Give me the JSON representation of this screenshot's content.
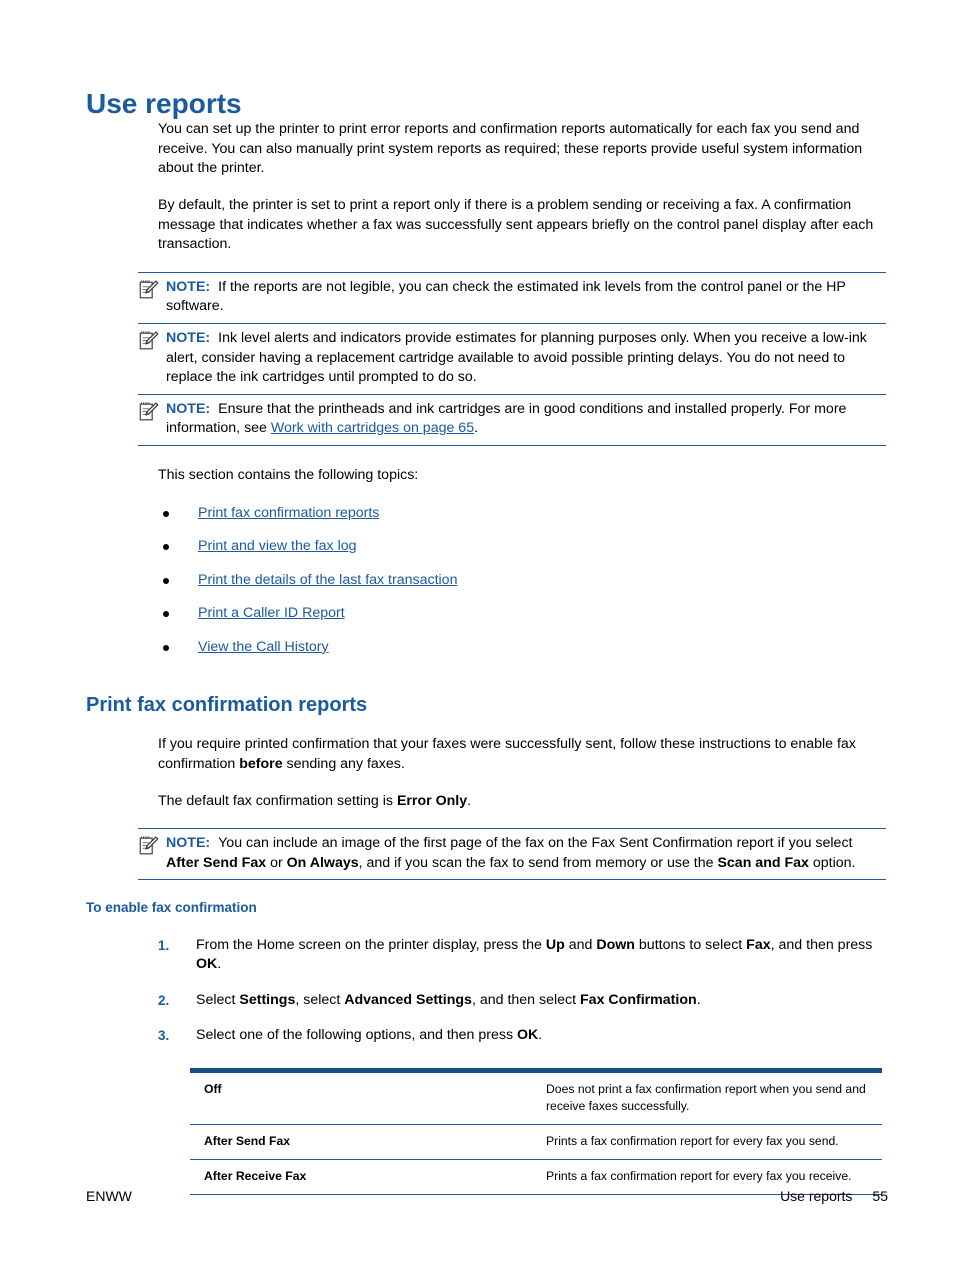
{
  "page": {
    "title": "Use reports",
    "accent_color": "#1a5a9e",
    "table_rule_color": "#1a4f86"
  },
  "intro": {
    "paragraph_1": "You can set up the printer to print error reports and confirmation reports automatically for each fax you send and receive. You can also manually print system reports as required; these reports provide useful system information about the printer.",
    "paragraph_2": "By default, the printer is set to print a report only if there is a problem sending or receiving a fax. A confirmation message that indicates whether a fax was successfully sent appears briefly on the control panel display after each transaction."
  },
  "notes": [
    {
      "label": "NOTE:",
      "icon": "note-pencil-icon",
      "text": "If the reports are not legible, you can check the estimated ink levels from the control panel or the HP software."
    },
    {
      "label": "NOTE:",
      "icon": "note-pencil-icon",
      "text": "Ink level alerts and indicators provide estimates for planning purposes only. When you receive a low-ink alert, consider having a replacement cartridge available to avoid possible printing delays. You do not need to replace the ink cartridges until prompted to do so."
    },
    {
      "label": "NOTE:",
      "icon": "note-pencil-icon",
      "text_before_link": "Ensure that the printheads and ink cartridges are in good conditions and installed properly. For more information, see ",
      "link_text": "Work with cartridges on page 65",
      "text_after_link": "."
    }
  ],
  "topics_intro": "This section contains the following topics:",
  "topics": [
    {
      "label": "Print fax confirmation reports"
    },
    {
      "label": "Print and view the fax log"
    },
    {
      "label": "Print the details of the last fax transaction"
    },
    {
      "label": "Print a Caller ID Report"
    },
    {
      "label": "View the Call History"
    }
  ],
  "section": {
    "heading": "Print fax confirmation reports",
    "paragraph_1_part1": "If you require printed confirmation that your faxes were successfully sent, follow these instructions to enable fax confirmation ",
    "paragraph_1_bold": "before",
    "paragraph_1_part2": " sending any faxes.",
    "paragraph_2_part1": "The default fax confirmation setting is ",
    "paragraph_2_bold": "Error Only",
    "paragraph_2_part2": ".",
    "note": {
      "label": "NOTE:",
      "icon": "note-pencil-icon",
      "part1": "You can include an image of the first page of the fax on the Fax Sent Confirmation report if you select ",
      "bold1": "After Send Fax",
      "part2": " or ",
      "bold2": "On Always",
      "part3": ", and if you scan the fax to send from memory or use the ",
      "bold3": "Scan and Fax",
      "part4": " option."
    },
    "subheading": "To enable fax confirmation",
    "steps": [
      {
        "number": "1.",
        "part1": "From the Home screen on the printer display, press the ",
        "bold1": "Up",
        "part2": " and ",
        "bold2": "Down",
        "part3": " buttons to select ",
        "bold3": "Fax",
        "part4": ", and then press ",
        "bold4": "OK",
        "part5": "."
      },
      {
        "number": "2.",
        "part1": "Select ",
        "bold1": "Settings",
        "part2": ", select ",
        "bold2": "Advanced Settings",
        "part3": ", and then select ",
        "bold3": "Fax Confirmation",
        "part4": ".",
        "bold4": "",
        "part5": ""
      },
      {
        "number": "3.",
        "part1": "Select one of the following options, and then press ",
        "bold1": "OK",
        "part2": ".",
        "bold2": "",
        "part3": "",
        "bold3": "",
        "part4": "",
        "bold4": "",
        "part5": ""
      }
    ]
  },
  "options_table": {
    "rows": [
      {
        "term": "Off",
        "description": "Does not print a fax confirmation report when you send and receive faxes successfully."
      },
      {
        "term": "After Send Fax",
        "description": "Prints a fax confirmation report for every fax you send."
      },
      {
        "term": "After Receive Fax",
        "description": "Prints a fax confirmation report for every fax you receive."
      }
    ]
  },
  "footer": {
    "left": "ENWW",
    "section_title": "Use reports",
    "page_number": "55"
  }
}
